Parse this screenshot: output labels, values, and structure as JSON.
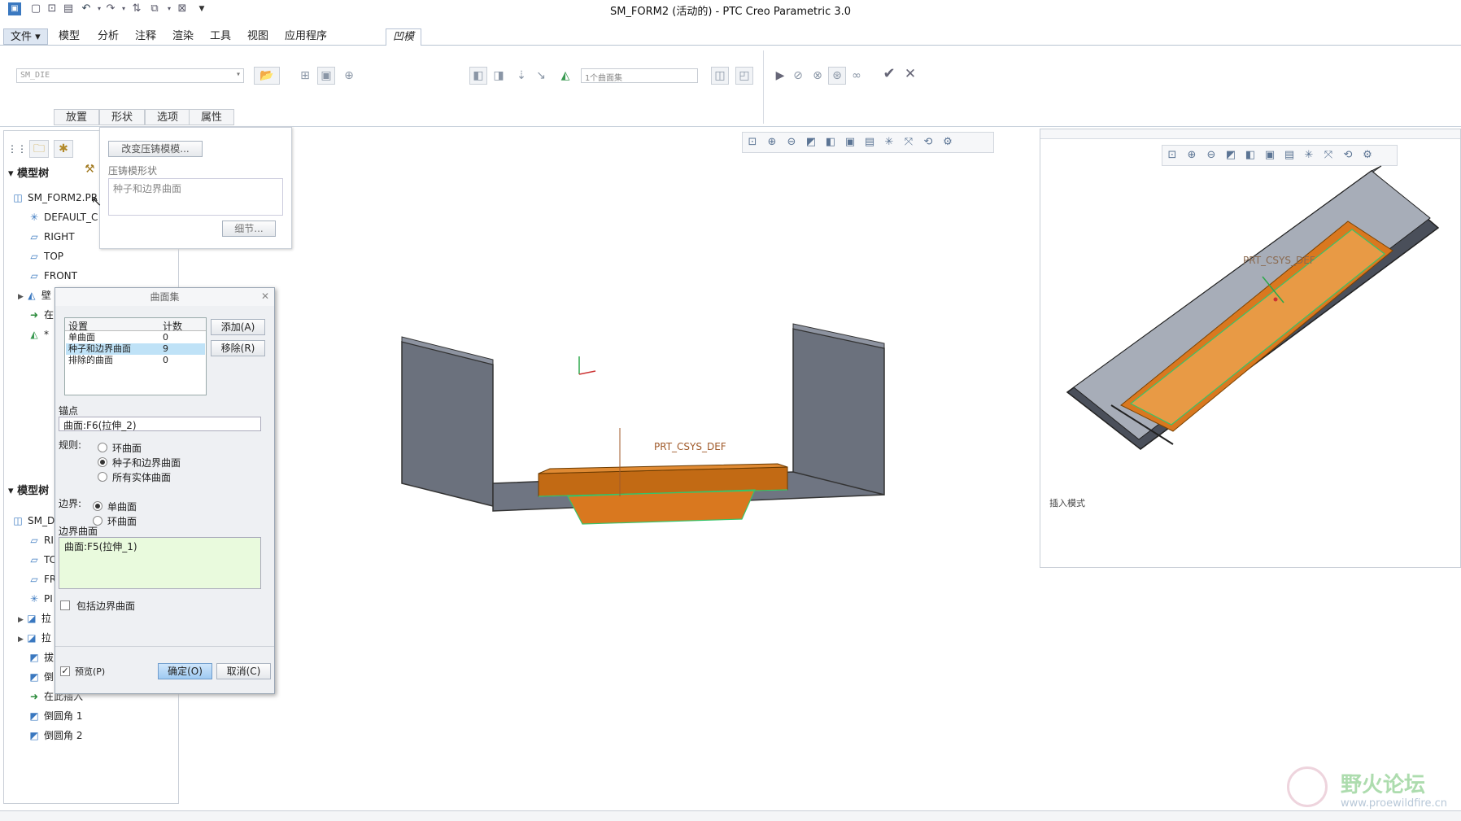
{
  "window": {
    "title": "SM_FORM2 (活动的) - PTC Creo Parametric 3.0"
  },
  "menu": {
    "file": "文件",
    "items": [
      "模型",
      "分析",
      "注释",
      "渲染",
      "工具",
      "视图",
      "应用程序"
    ],
    "active": "凹模"
  },
  "dashboard": {
    "die_model_value": "SM_DIE",
    "surface_set_value": "1个曲面集",
    "subtabs": [
      "放置",
      "形状",
      "选项",
      "属性"
    ]
  },
  "placement_popup": {
    "change_button": "改变压铸模模...",
    "shape_label": "压铸模形状",
    "shape_value": "种子和边界曲面",
    "details_button": "细节..."
  },
  "model_tree_top": {
    "header": "模型树",
    "items": [
      "SM_FORM2.PR",
      "DEFAULT_C",
      "RIGHT",
      "TOP",
      "FRONT",
      "壁",
      "在",
      "*"
    ]
  },
  "model_tree_bottom": {
    "header": "模型树",
    "items": [
      "SM_D",
      "RI",
      "TC",
      "FR",
      "PI",
      "拉",
      "拉",
      "拔",
      "倒",
      "在此插入",
      "倒圆角 1",
      "倒圆角 2"
    ]
  },
  "surface_set_dialog": {
    "title": "曲面集",
    "columns": [
      "设置",
      "计数"
    ],
    "rows": [
      {
        "name": "单曲面",
        "count": "0"
      },
      {
        "name": "种子和边界曲面",
        "count": "9"
      },
      {
        "name": "排除的曲面",
        "count": "0"
      }
    ],
    "add_button": "添加(A)",
    "remove_button": "移除(R)",
    "anchor_label": "锚点",
    "anchor_value": "曲面:F6(拉伸_2)",
    "rule_label": "规则:",
    "rule_options": [
      "环曲面",
      "种子和边界曲面",
      "所有实体曲面"
    ],
    "boundary_label": "边界:",
    "boundary_options": [
      "单曲面",
      "环曲面"
    ],
    "boundary_surface_label": "边界曲面",
    "boundary_surface_value": "曲面:F5(拉伸_1)",
    "include_boundary": "包括边界曲面",
    "preview": "预览(P)",
    "ok_button": "确定(O)",
    "cancel_button": "取消(C)"
  },
  "viewport": {
    "csys_label": "PRT_CSYS_DEF",
    "right_csys_label": "PRT_CSYS_DEF",
    "insert_mode": "插入模式"
  },
  "watermark": {
    "name": "野火论坛",
    "url": "www.proewildfire.cn"
  },
  "colors": {
    "part_gray": "#6b717d",
    "die_orange": "#d9781f",
    "edge_green": "#37c46a",
    "accent_blue": "#3a78c0"
  }
}
